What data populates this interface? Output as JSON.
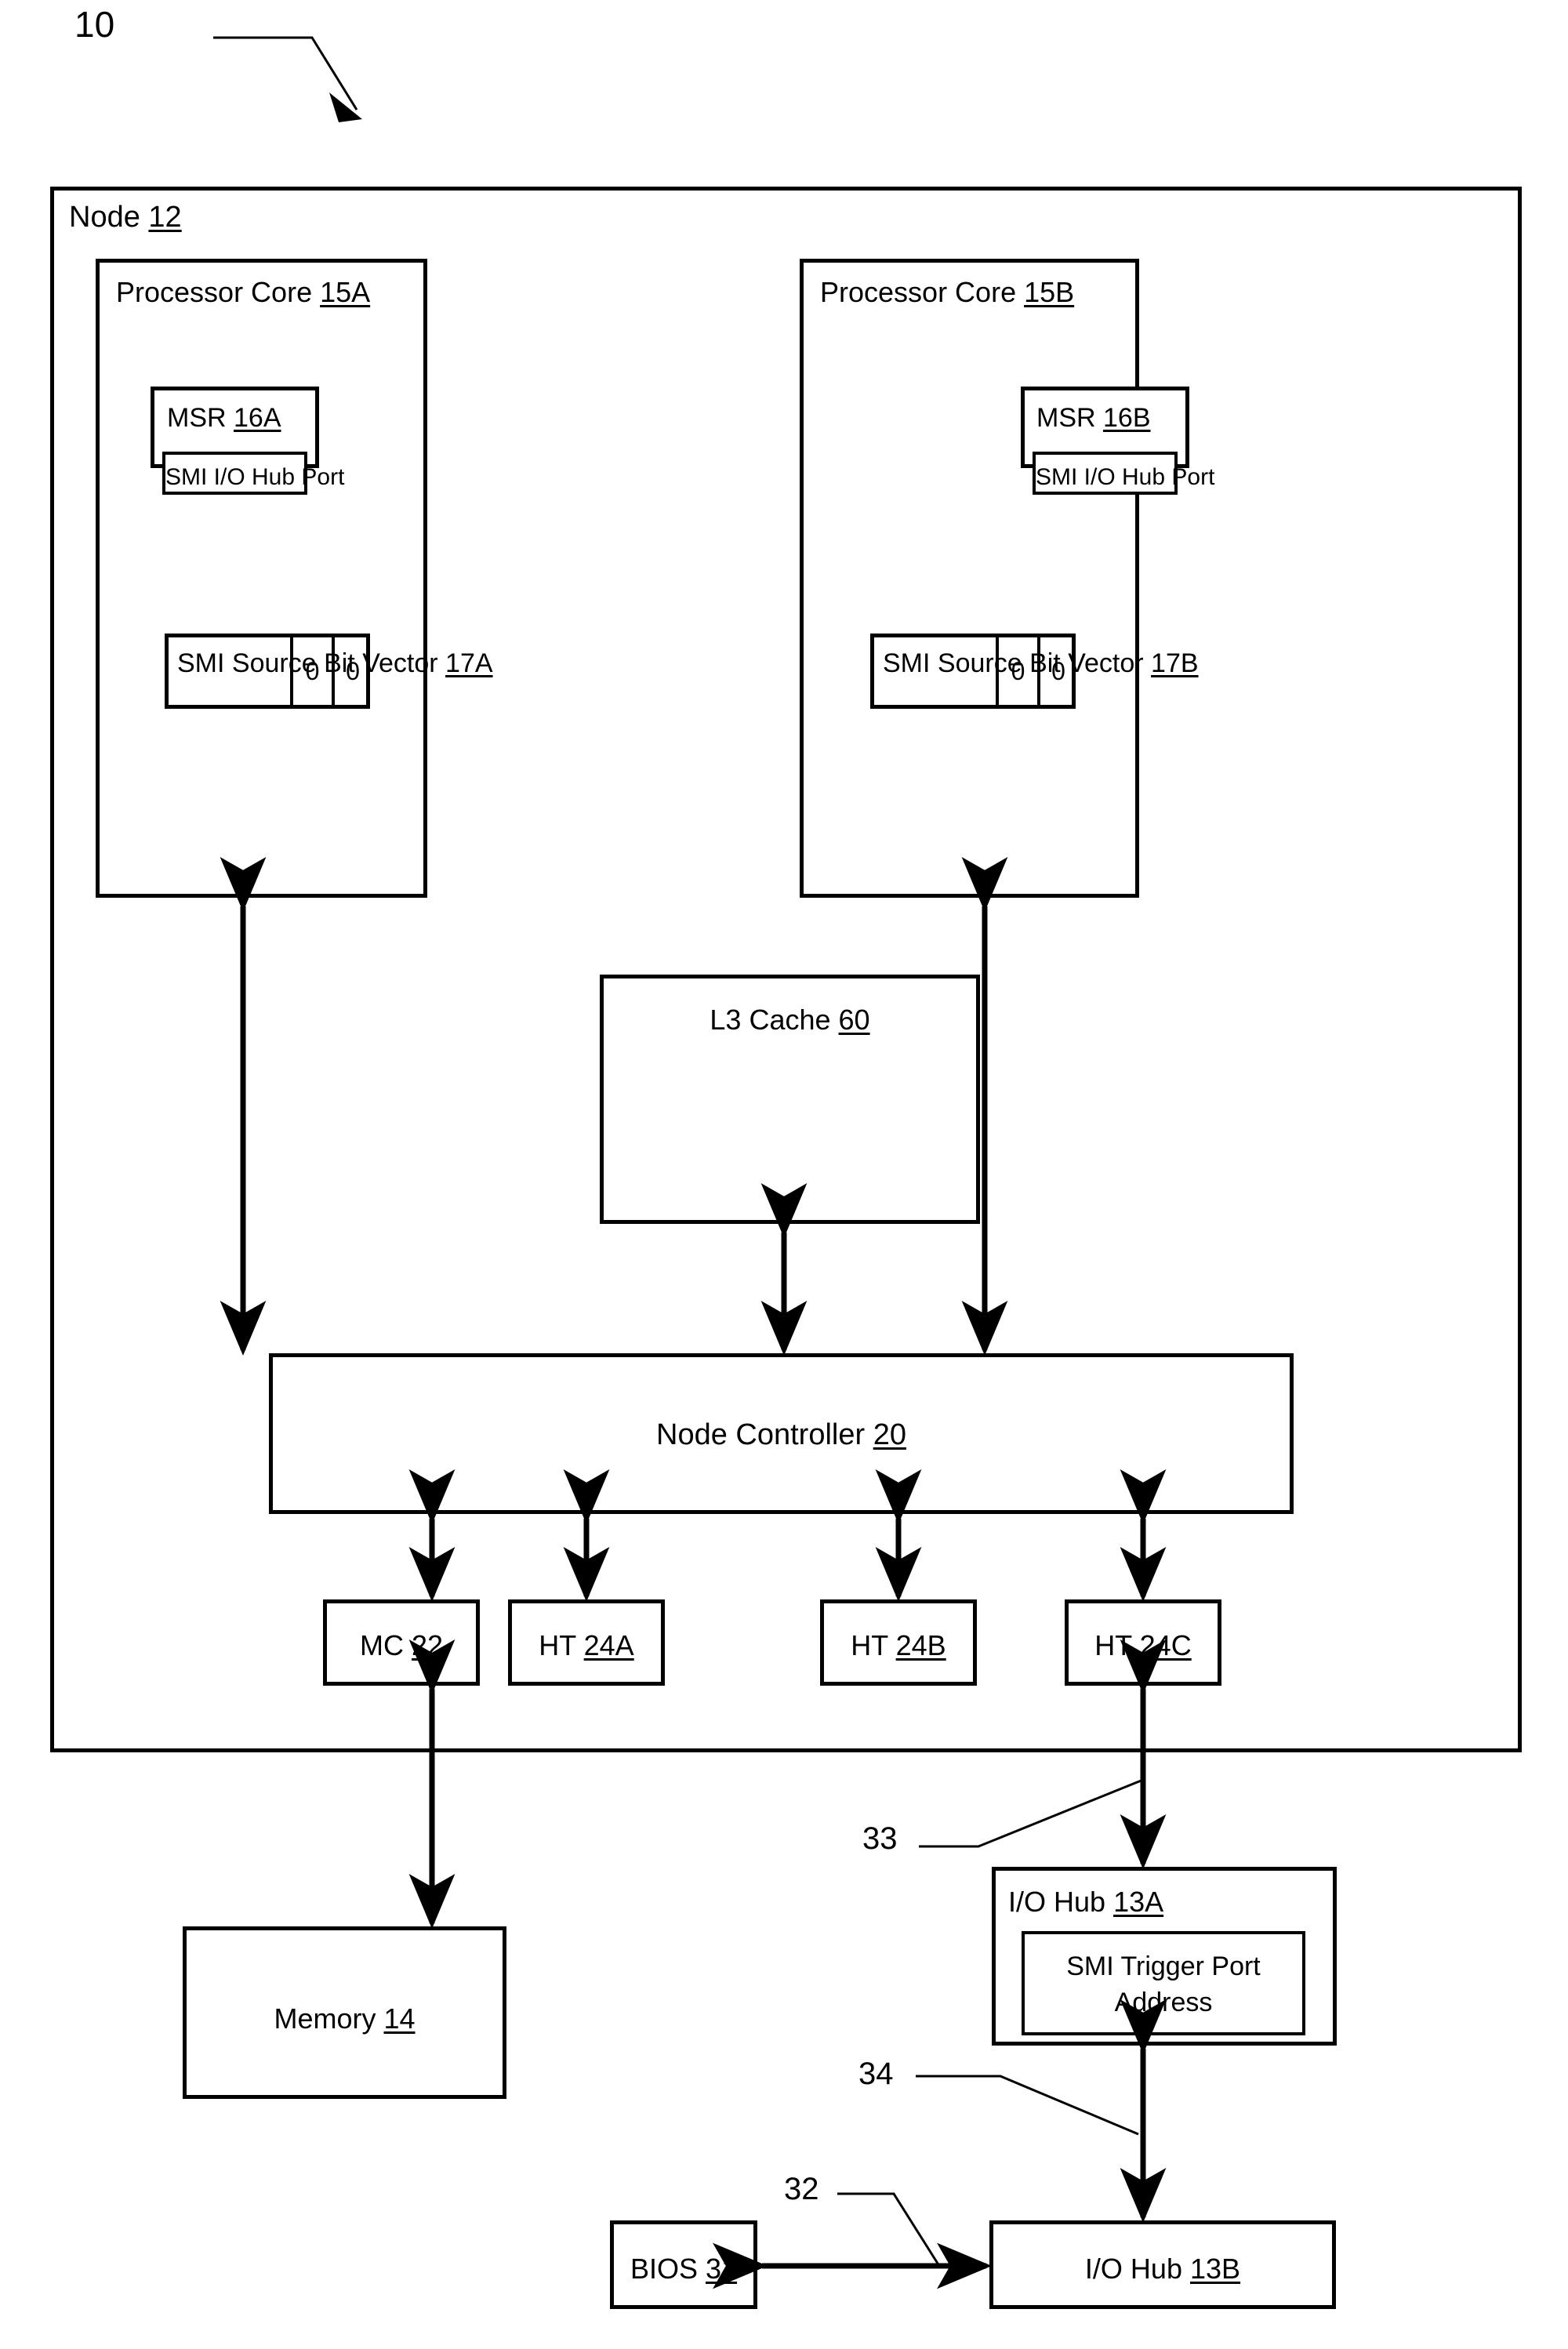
{
  "figure": {
    "reference_numeral": "10"
  },
  "node": {
    "label": "Node",
    "ref": "12"
  },
  "cores": [
    {
      "label": "Processor Core",
      "ref": "15A",
      "msr": {
        "label": "MSR",
        "ref": "16A",
        "field": "SMI I/O Hub Port"
      },
      "bit_vector": {
        "label": "SMI Source Bit Vector",
        "ref": "17A",
        "bits": [
          "0",
          "0"
        ]
      }
    },
    {
      "label": "Processor Core",
      "ref": "15B",
      "msr": {
        "label": "MSR",
        "ref": "16B",
        "field": "SMI I/O Hub Port"
      },
      "bit_vector": {
        "label": "SMI Source Bit Vector",
        "ref": "17B",
        "bits": [
          "0",
          "0"
        ]
      }
    }
  ],
  "l3_cache": {
    "label": "L3 Cache",
    "ref": "60"
  },
  "node_controller": {
    "label": "Node Controller",
    "ref": "20"
  },
  "interfaces": [
    {
      "label": "MC",
      "ref": "22"
    },
    {
      "label": "HT",
      "ref": "24A"
    },
    {
      "label": "HT",
      "ref": "24B"
    },
    {
      "label": "HT",
      "ref": "24C"
    }
  ],
  "memory": {
    "label": "Memory",
    "ref": "14"
  },
  "io_hub_a": {
    "label": "I/O Hub",
    "ref": "13A",
    "field_line1": "SMI Trigger Port",
    "field_line2": "Address"
  },
  "io_hub_b": {
    "label": "I/O Hub",
    "ref": "13B"
  },
  "bios": {
    "label": "BIOS",
    "ref": "31"
  },
  "link_labels": {
    "ht_to_hub_a": "33",
    "hub_a_to_hub_b": "34",
    "bios_to_hub_b": "32"
  },
  "colors": {
    "line": "#000000",
    "background": "#ffffff"
  }
}
